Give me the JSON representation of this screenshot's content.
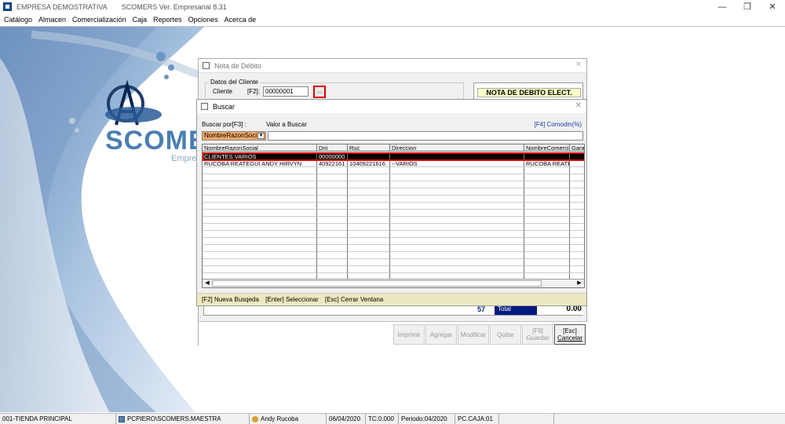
{
  "window": {
    "company": "EMPRESA DEMOSTRATIVA",
    "version": "SCOMERS Ver. Empresarial  8.31"
  },
  "menu": [
    "Catálogo",
    "Almacen",
    "Comercialización",
    "Caja",
    "Reportes",
    "Opciones",
    "Acerca de"
  ],
  "logo": {
    "text": "SCOMERS",
    "sub": "Empresarial"
  },
  "nota": {
    "title": "Nota de Débito",
    "group_label": "Datos del Cliente",
    "cliente_label": "Cliente",
    "f2_label": "[F2]:",
    "cliente_value": "00000001",
    "lookup_label": "...",
    "doc_title": "NOTA DE DEBITO ELECT.",
    "total_count": "57",
    "total_label": "Total",
    "total_value": "0.00",
    "buttons": [
      {
        "label": "Imprimir",
        "sub": "",
        "active": false
      },
      {
        "label": "Agregar",
        "sub": "",
        "active": false
      },
      {
        "label": "Modificar",
        "sub": "",
        "active": false
      },
      {
        "label": "Quitar",
        "sub": "",
        "active": false
      },
      {
        "label": "Guardar",
        "sub": "[F9]",
        "active": false
      },
      {
        "label": "Cancelar",
        "sub": "[Esc]",
        "active": true
      }
    ]
  },
  "buscar": {
    "title": "Buscar",
    "buscar_por_label": "Buscar por[F3] :",
    "valor_label": "Valor a Buscar",
    "comodin_label": "[F4] Comodin(%)",
    "campo_selected": "NombreRazonSoci",
    "valor_value": "",
    "columns": [
      "NombreRazonSocial",
      "Dni",
      "Ruc",
      "Direccion",
      "NombreComerci",
      "Gara"
    ],
    "rows": [
      [
        "CLIENTES VARIOS",
        "00000000",
        "",
        "",
        "",
        ""
      ],
      [
        "RUCOBA REATEGUI ANDY HIRVYN",
        "40922161",
        "10409221616",
        "--VARIOS",
        "RUCOBA REATE",
        ""
      ]
    ],
    "footer": [
      "[F2] Nueva Busqeda",
      "[Enter] Seleccionar",
      "[Esc] Cerrar Ventana"
    ]
  },
  "status": [
    "001-TIENDA PRINCIPAL",
    "PCPIERO\\SCOMERS:MAESTRA",
    "Andy Rucoba",
    "06/04/2020",
    "TC:0.000",
    "Periodo:04/2020",
    "PC.CAJA:01"
  ]
}
